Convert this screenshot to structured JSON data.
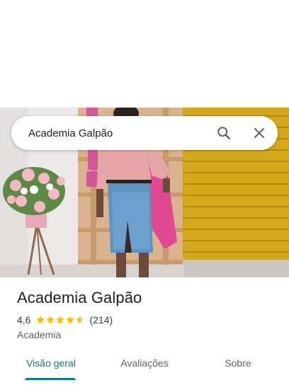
{
  "search": {
    "query": "Academia Galpão"
  },
  "place": {
    "name": "Academia Galpão",
    "rating": "4,6",
    "rating_value": 4.6,
    "review_count": "(214)",
    "category": "Academia"
  },
  "tabs": [
    {
      "label": "Visão geral",
      "active": true
    },
    {
      "label": "Avaliações",
      "active": false
    },
    {
      "label": "Sobre",
      "active": false
    }
  ],
  "colors": {
    "accent": "#0b7a8a",
    "star": "#fbbc04",
    "star_empty": "#dadce0"
  },
  "icons": {
    "search": "search-icon",
    "close": "close-icon",
    "star": "star-icon"
  }
}
